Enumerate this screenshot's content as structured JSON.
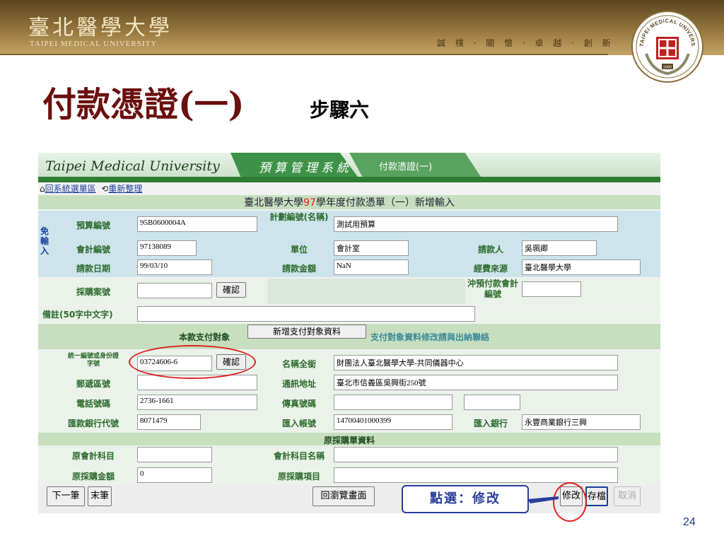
{
  "header": {
    "university_zh": "臺北醫學大學",
    "university_en": "TAIPEI MEDICAL UNIVERSITY",
    "motto": "誠 樸 · 關 懷 · 卓 越 · 創 新",
    "emblem_text": "TAIPEI MEDICAL UNIVERSITY",
    "emblem_year": "1960"
  },
  "slide": {
    "title": "付款憑證(一)",
    "subtitle": "步驟六",
    "page_number": "24"
  },
  "app": {
    "brand": "Taipei Medical University",
    "tab_system": "預算管理系統",
    "tab_current": "付款憑證(一)",
    "nav": {
      "back": "回系統選單區",
      "refresh": "重新整理"
    },
    "form_title_pre": "臺北醫學大學",
    "form_year": "97",
    "form_title_post": "學年度付款憑單（一）新增輸入",
    "side_label": "免輸入",
    "fields": {
      "budget_no_label": "預算編號",
      "budget_no": "95B0600004A",
      "plan_label": "計劃編號(名稱)",
      "plan": "測試用預算",
      "acct_no_label": "會計編號",
      "acct_no": "97138089",
      "unit_label": "單位",
      "unit": "會計室",
      "applicant_label": "請款人",
      "applicant": "吳珮卿",
      "date_label": "請款日期",
      "date": "99/03/10",
      "amount_label": "請款金額",
      "amount": "NaN",
      "fund_label": "經費來源",
      "fund": "臺北醫學大學",
      "purchase_label": "採購案號",
      "purchase": "",
      "prepay_label": "沖預付款會計編號",
      "prepay": "",
      "note_label": "備註(50字中文字)",
      "note": ""
    },
    "payee": {
      "section_label": "本款支付對象",
      "add_button": "新增支付對象資料",
      "notice": "支付對象資料修改請與出納聯絡",
      "id_label": "統一編號或身份證字號",
      "id_value": "03724606-6",
      "confirm": "確認",
      "fullname_label": "名稱全銜",
      "fullname": "財團法人臺北醫學大學-共同儀器中心",
      "zip_label": "郵遞區號",
      "zip": "",
      "address_label": "通訊地址",
      "address": "臺北市信義區吳興街250號",
      "phone_label": "電話號碼",
      "phone": "2736-1661",
      "fax_label": "傳真號碼",
      "fax": "",
      "bank_code_label": "匯款銀行代號",
      "bank_code": "8071479",
      "account_label": "匯入帳號",
      "account": "14700401000399",
      "bank_label": "匯入銀行",
      "bank": "永豐商業銀行三興"
    },
    "orig": {
      "section_label": "原採購單資料",
      "acct_item_label": "原會計科目",
      "acct_item": "",
      "acct_item_name_label": "會計科目名稱",
      "acct_item_name": "",
      "amount_label": "原採購金額",
      "amount": "0",
      "item_label": "原採購項目",
      "item": ""
    },
    "buttons": {
      "next": "下一筆",
      "last": "末筆",
      "browse": "回瀏覽畫面",
      "modify": "修改",
      "save": "存檔",
      "cancel": "取消"
    },
    "confirm_label": "確認"
  },
  "callout": "點選：修改"
}
